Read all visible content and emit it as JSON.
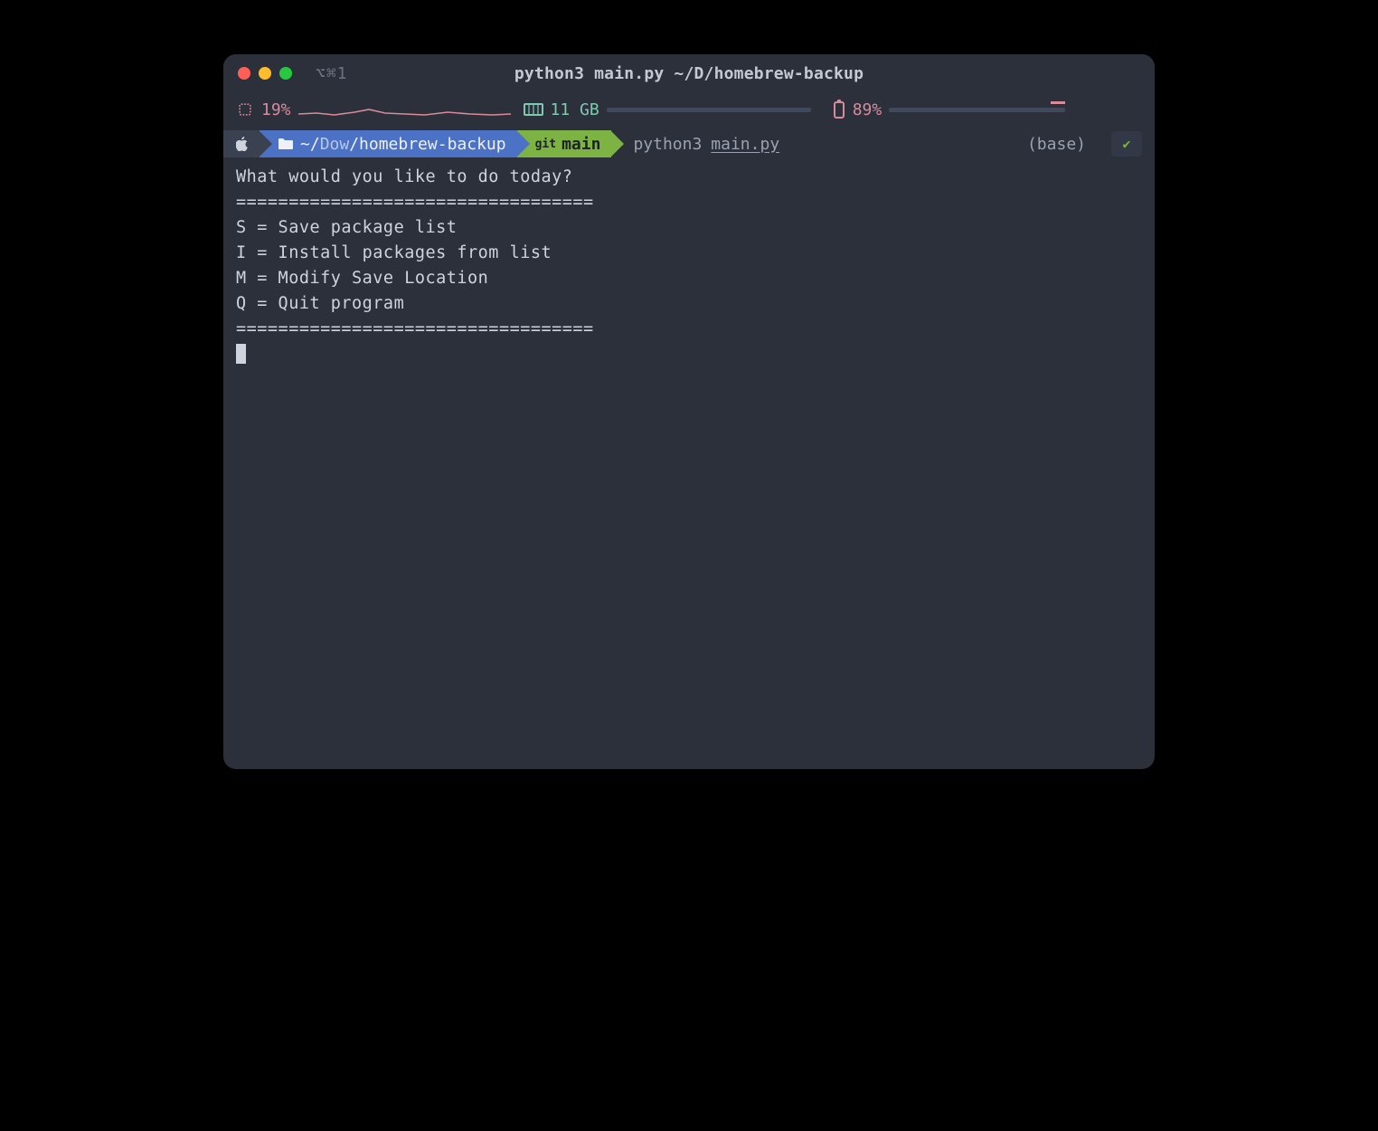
{
  "titlebar": {
    "tab_indicator": "⌥⌘1",
    "window_title": "python3 main.py  ~/D/homebrew-backup"
  },
  "status": {
    "cpu_percent": "19%",
    "mem_value": "11 GB",
    "bat_percent": "89%"
  },
  "prompt": {
    "path_prefix": "~/",
    "path_dim": "Dow",
    "path_rest": "/homebrew-backup",
    "git_label": "git",
    "git_branch": "main",
    "command": "python3",
    "command_arg": "main.py",
    "env": "(base)",
    "check": "✔"
  },
  "output": {
    "line1": "What would you like to do today?",
    "sep": "==================================",
    "opt_s": "S = Save package list",
    "opt_i": "I = Install packages from list",
    "opt_m": "M = Modify Save Location",
    "opt_q": "Q = Quit program"
  }
}
